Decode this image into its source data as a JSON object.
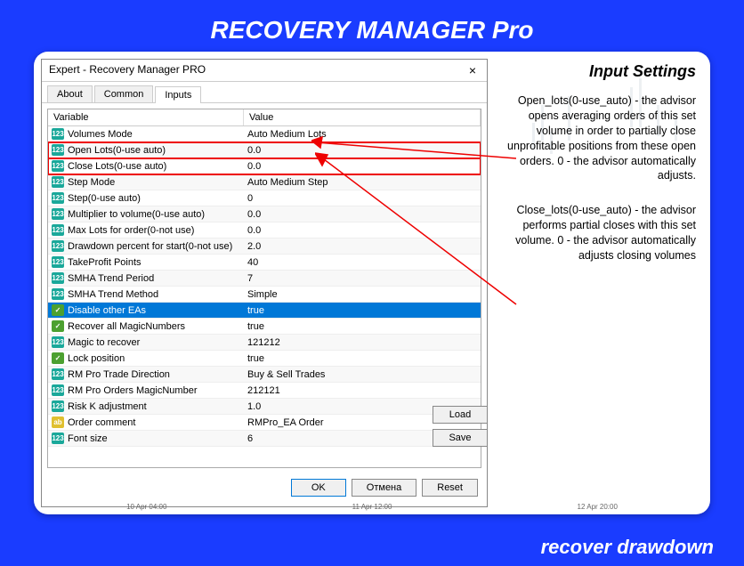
{
  "brand": {
    "title": "RECOVERY MANAGER Pro",
    "footer": "recover drawdown"
  },
  "dialog": {
    "title": "Expert - Recovery Manager PRO",
    "close": "×",
    "tabs": [
      "About",
      "Common",
      "Inputs"
    ],
    "active_tab": 2,
    "columns": {
      "variable": "Variable",
      "value": "Value"
    },
    "rows": [
      {
        "icon": "teal",
        "label": "Volumes Mode",
        "value": "Auto Medium Lots"
      },
      {
        "icon": "teal",
        "label": "Open Lots(0-use auto)",
        "value": "0.0",
        "hl": true
      },
      {
        "icon": "teal",
        "label": "Close Lots(0-use auto)",
        "value": "0.0",
        "hl": true
      },
      {
        "icon": "teal",
        "label": "Step Mode",
        "value": "Auto Medium Step"
      },
      {
        "icon": "teal",
        "label": "Step(0-use auto)",
        "value": "0"
      },
      {
        "icon": "teal",
        "label": "Multiplier to volume(0-use auto)",
        "value": "0.0"
      },
      {
        "icon": "teal",
        "label": "Max Lots for order(0-not use)",
        "value": "0.0"
      },
      {
        "icon": "teal",
        "label": "Drawdown percent for start(0-not use)",
        "value": "2.0"
      },
      {
        "icon": "teal",
        "label": "TakeProfit Points",
        "value": "40"
      },
      {
        "icon": "teal",
        "label": "SMHA Trend Period",
        "value": "7"
      },
      {
        "icon": "teal",
        "label": "SMHA Trend Method",
        "value": "Simple"
      },
      {
        "icon": "green",
        "label": "Disable other EAs",
        "value": "true",
        "selected": true
      },
      {
        "icon": "green",
        "label": "Recover all MagicNumbers",
        "value": "true"
      },
      {
        "icon": "teal",
        "label": "Magic to recover",
        "value": "121212"
      },
      {
        "icon": "green",
        "label": "Lock position",
        "value": "true"
      },
      {
        "icon": "teal",
        "label": "RM Pro Trade Direction",
        "value": "Buy & Sell Trades"
      },
      {
        "icon": "teal",
        "label": "RM Pro Orders MagicNumber",
        "value": "212121"
      },
      {
        "icon": "teal",
        "label": "Risk K adjustment",
        "value": "1.0"
      },
      {
        "icon": "yellow",
        "label": "Order comment",
        "value": "RMPro_EA Order"
      },
      {
        "icon": "teal",
        "label": "Font size",
        "value": "6"
      }
    ],
    "buttons": {
      "ok": "OK",
      "cancel": "Отмена",
      "reset": "Reset",
      "load": "Load",
      "save": "Save"
    }
  },
  "annotations": {
    "title": "Input Settings",
    "text1": "Open_lots(0-use_auto) - the advisor opens averaging orders of this set volume in order to partially close unprofitable positions from these open orders. 0 - the advisor automatically adjusts.",
    "text2": "Close_lots(0-use_auto) - the advisor performs partial closes with this set volume. 0 - the advisor automatically adjusts closing volumes"
  },
  "timeaxis": [
    "10 Apr 04:00",
    "11 Apr 12:00",
    "12 Apr 20:00"
  ]
}
